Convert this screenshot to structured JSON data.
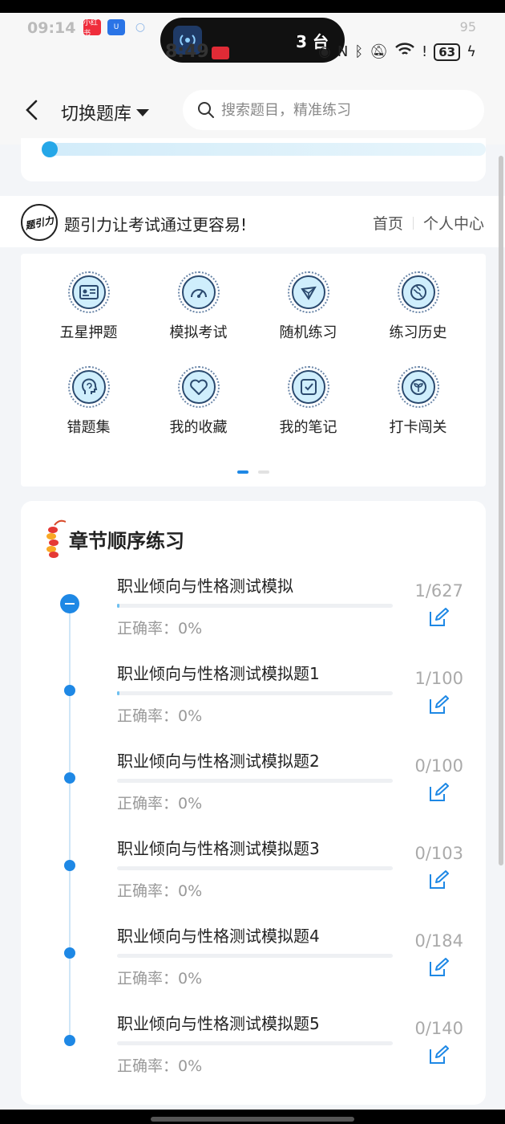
{
  "status_bar": {
    "time_ghost": "09:14",
    "time": "8:49",
    "island_text": "3 台",
    "battery": "63",
    "ghost_battery": "95",
    "app_badges": [
      {
        "label": "小红书",
        "color": "#ef2d3c"
      },
      {
        "label": "U",
        "color": "#2a74e6"
      },
      {
        "label": "",
        "color": "#8ab4e8"
      }
    ]
  },
  "nav": {
    "bank_switch_label": "切换题库",
    "search_placeholder": "搜索题目，精准练习"
  },
  "brand": {
    "logo_text": "题引力",
    "slogan": "题引力让考试通过更容易!",
    "links": [
      "首页",
      "个人中心"
    ]
  },
  "grid": {
    "items": [
      {
        "label": "五星押题",
        "icon": "id-card-icon"
      },
      {
        "label": "模拟考试",
        "icon": "gauge-icon"
      },
      {
        "label": "随机练习",
        "icon": "compass-icon"
      },
      {
        "label": "练习历史",
        "icon": "history-globe-icon"
      },
      {
        "label": "错题集",
        "icon": "head-icon"
      },
      {
        "label": "我的收藏",
        "icon": "heart-icon"
      },
      {
        "label": "我的笔记",
        "icon": "note-check-icon"
      },
      {
        "label": "打卡闯关",
        "icon": "sprout-icon"
      }
    ],
    "pages": 2,
    "active_page": 1
  },
  "chapters": {
    "title": "章节顺序练习",
    "items": [
      {
        "name": "职业倾向与性格测试模拟",
        "accuracy": "正确率：0%",
        "count": "1/627",
        "progress": 0.0016
      },
      {
        "name": "职业倾向与性格测试模拟题1",
        "accuracy": "正确率：0%",
        "count": "1/100",
        "progress": 0.01
      },
      {
        "name": "职业倾向与性格测试模拟题2",
        "accuracy": "正确率：0%",
        "count": "0/100",
        "progress": 0
      },
      {
        "name": "职业倾向与性格测试模拟题3",
        "accuracy": "正确率：0%",
        "count": "0/103",
        "progress": 0
      },
      {
        "name": "职业倾向与性格测试模拟题4",
        "accuracy": "正确率：0%",
        "count": "0/184",
        "progress": 0
      },
      {
        "name": "职业倾向与性格测试模拟题5",
        "accuracy": "正确率：0%",
        "count": "0/140",
        "progress": 0
      }
    ]
  },
  "colors": {
    "accent": "#1e88e5",
    "icon_fill": "#cfeefc",
    "muted_text": "#999999"
  }
}
